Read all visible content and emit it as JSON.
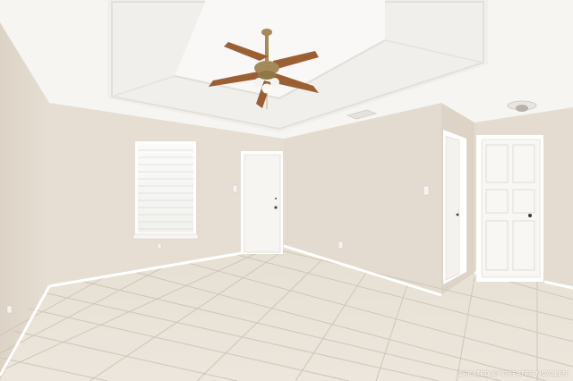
{
  "photo": {
    "subject": "Empty room with tile floor, tray ceiling and ceiling fan",
    "watermark_text": "CREATED BY GREATER MCALLEN",
    "colors": {
      "wall": "#e7dfd4",
      "wall_shadow": "#d9d0c4",
      "ceiling": "#f7f6f3",
      "floor": "#e9e2d7",
      "grout": "#cfc6b9",
      "door": "#f8f7f4",
      "trim": "#ffffff",
      "fan_blade": "#9c5f34",
      "fan_brass": "#a48a58"
    }
  }
}
